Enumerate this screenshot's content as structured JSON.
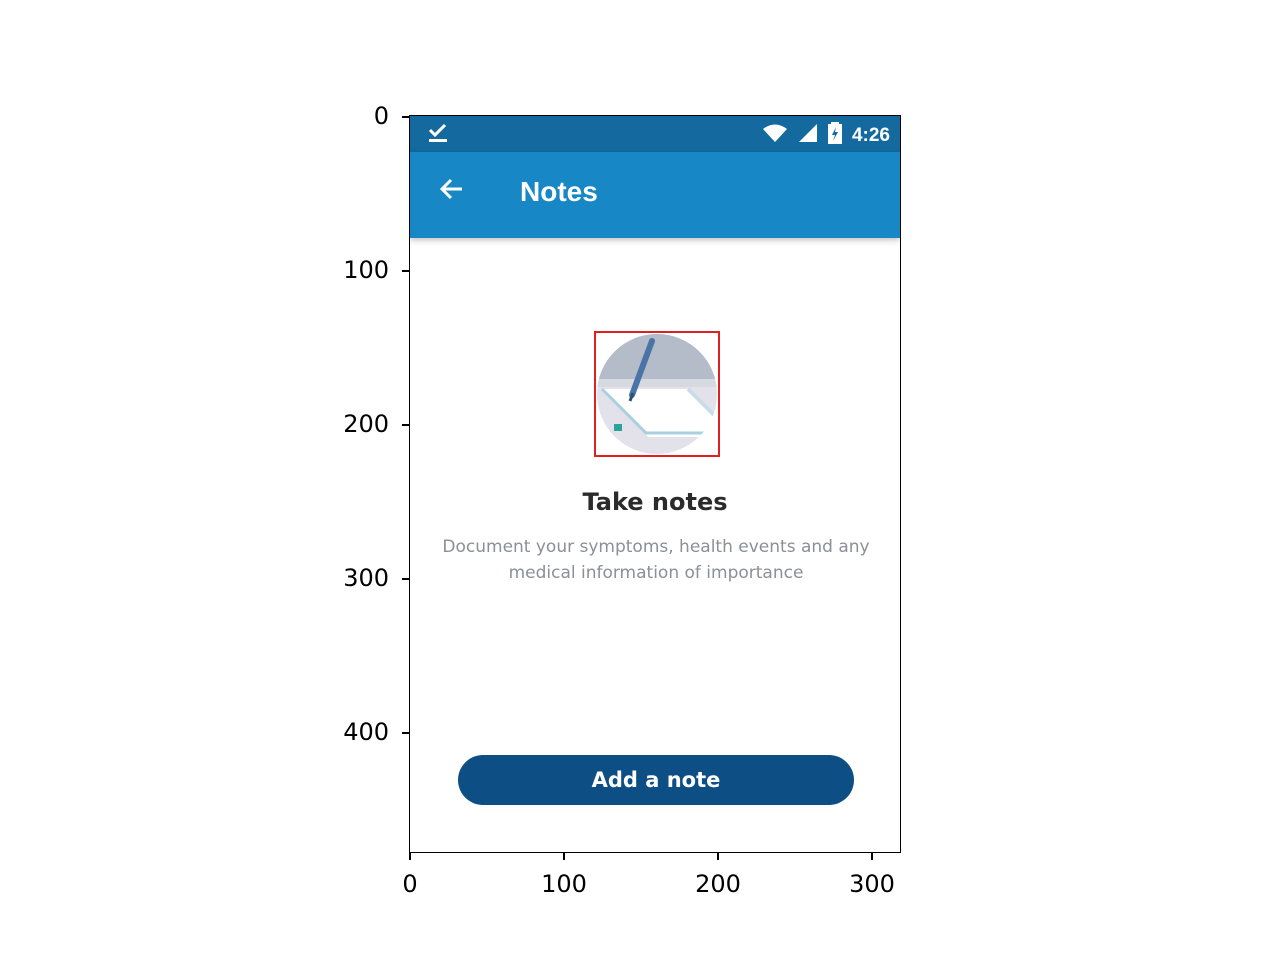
{
  "status_bar": {
    "time": "4:26",
    "left_icon": "download-done-icon",
    "icons": [
      "wifi-icon",
      "signal-icon",
      "battery-charging-icon"
    ]
  },
  "app_bar": {
    "title": "Notes",
    "back_icon": "arrow-back-icon"
  },
  "empty_state": {
    "illustration": "notepad-pen-icon",
    "title": "Take notes",
    "description": "Document your symptoms, health events and any medical information of importance"
  },
  "actions": {
    "add_label": "Add a note"
  },
  "axes": {
    "y_ticks": [
      "0",
      "100",
      "200",
      "300",
      "400"
    ],
    "x_ticks": [
      "0",
      "100",
      "200",
      "300"
    ]
  },
  "colors": {
    "status_bar": "#146a9f",
    "app_bar": "#1787c6",
    "button": "#0d4f85",
    "highlight": "#e02020"
  }
}
